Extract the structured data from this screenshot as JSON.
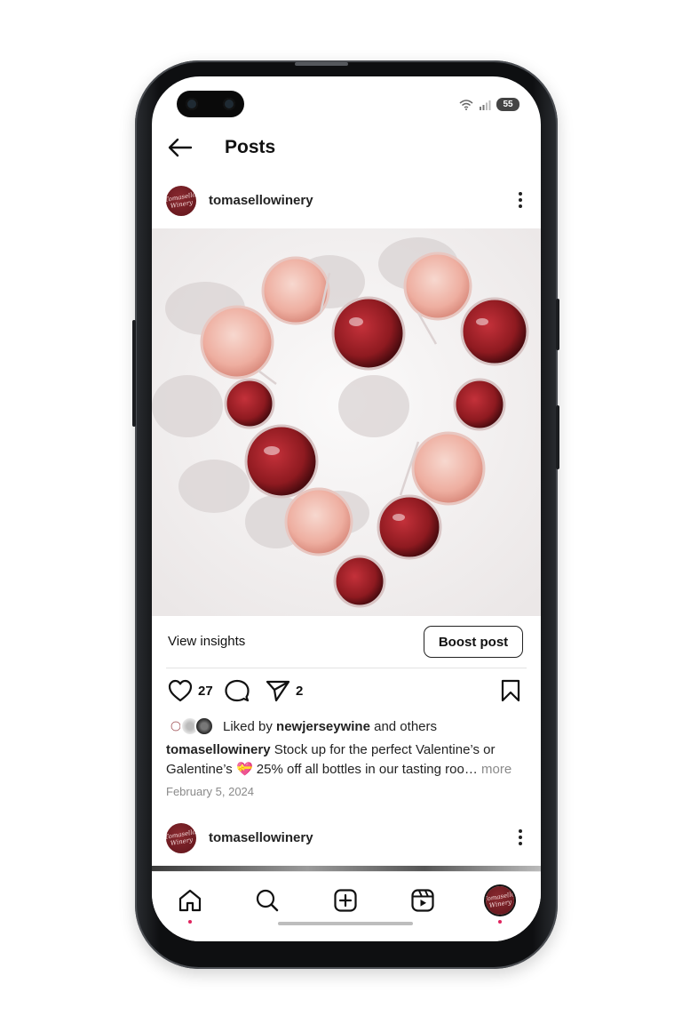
{
  "status_bar": {
    "battery": "55",
    "wifi_icon": "wifi-icon",
    "signal_icon": "signal-icon"
  },
  "header": {
    "title": "Posts",
    "back_icon": "arrow-left-icon"
  },
  "post": {
    "username": "tomasellowinery",
    "avatar_text": "Tomasello Winery",
    "image_description_icon": "wine-glasses-heart-photo",
    "view_insights_label": "View insights",
    "boost_label": "Boost post",
    "likes_count": "27",
    "shares_count": "2",
    "liked_by_prefix": "Liked by",
    "liked_by_user": "newjerseywine",
    "liked_by_suffix": "and others",
    "caption_user": "tomasellowinery",
    "caption_text": "Stock up for the perfect Valentine’s or Galentine’s 💝 25% off all bottles in our tasting roo…",
    "caption_more": "more",
    "date": "February 5, 2024"
  },
  "next_post": {
    "username": "tomasellowinery"
  },
  "bottom_nav": {
    "items": [
      "home-icon",
      "search-icon",
      "create-icon",
      "reels-icon",
      "profile-avatar"
    ]
  },
  "colors": {
    "accent_red": "#e0245e",
    "wine": "#6b1a20",
    "text": "#111111",
    "muted": "#8a8a8a"
  }
}
